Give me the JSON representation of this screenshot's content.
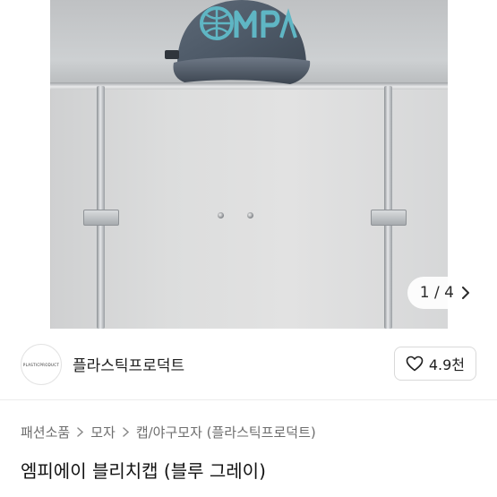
{
  "gallery": {
    "counter_current": "1",
    "counter_separator": "/",
    "counter_total": "4",
    "next_icon": "chevron-right-icon"
  },
  "seller": {
    "avatar_text": "PLASTICPRODUCT",
    "name": "플라스틱프로덕트"
  },
  "like_button": {
    "icon": "heart-outline-icon",
    "count": "4.9천"
  },
  "breadcrumb": [
    "패션소품",
    "모자",
    "캡/야구모자 (플라스틱프로덕트)"
  ],
  "product": {
    "title": "엠피에이 블리치캡 (블루 그레이)"
  },
  "colors": {
    "cap_body": "#4e5a68",
    "cap_logo": "#5fb6c4",
    "text_primary": "#1e1e1e",
    "text_secondary": "#6e6e6e"
  }
}
